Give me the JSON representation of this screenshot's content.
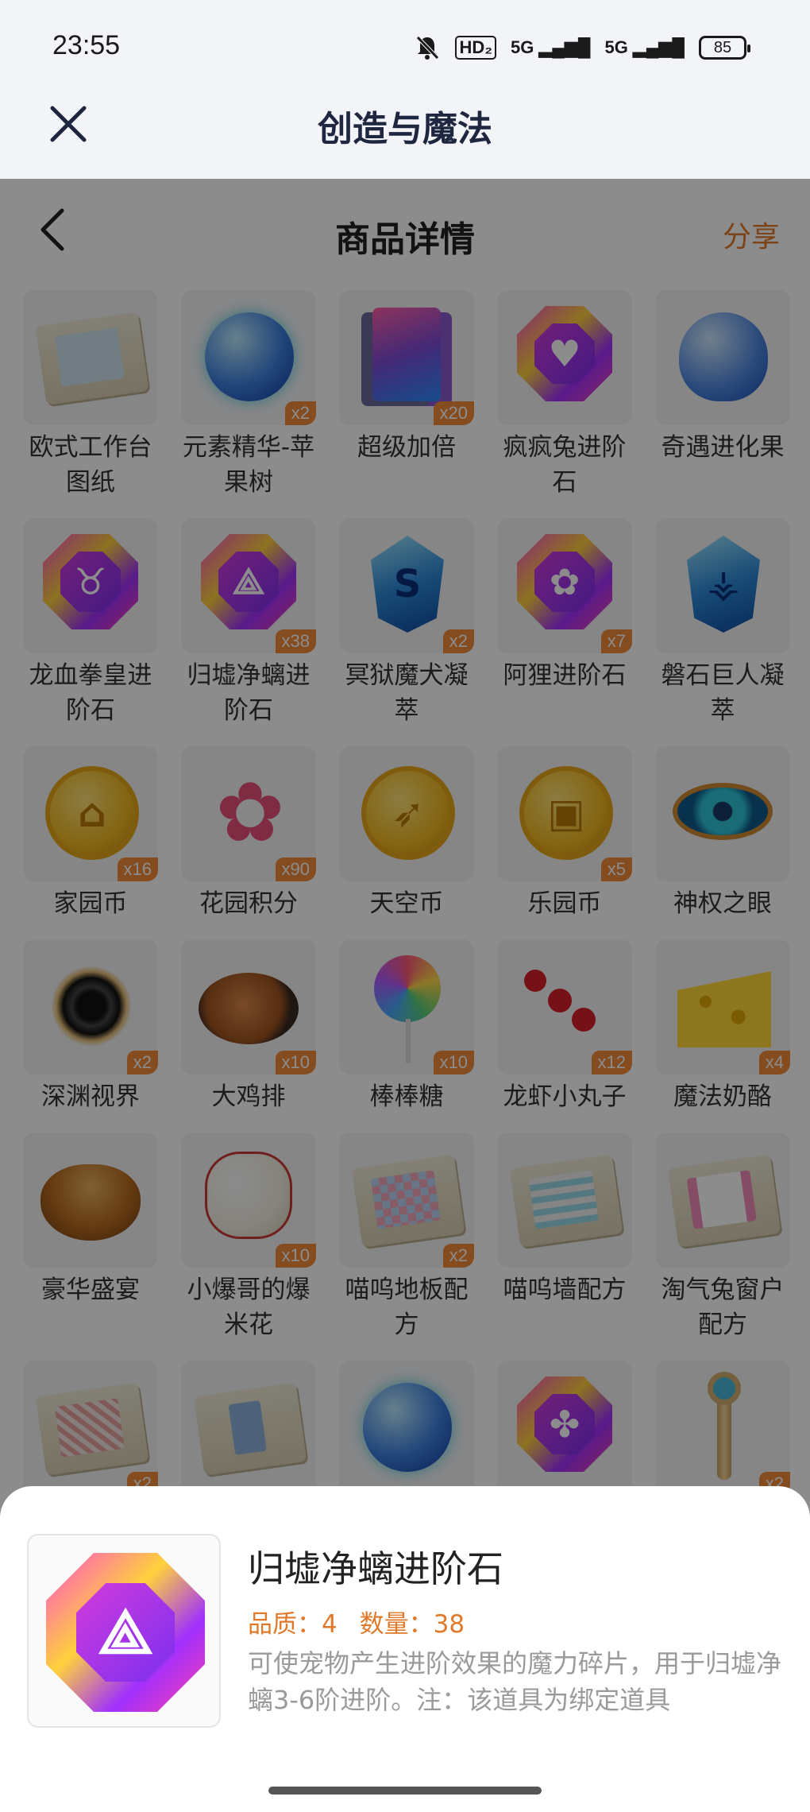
{
  "status_bar": {
    "time": "23:55",
    "hd": "HD₂",
    "sig1": "5G",
    "sig2": "5G",
    "battery": "85"
  },
  "app": {
    "title": "创造与魔法"
  },
  "page": {
    "title": "商品详情",
    "share": "分享"
  },
  "items": [
    {
      "name": "欧式工作台图纸",
      "qty": ""
    },
    {
      "name": "元素精华-苹果树",
      "qty": "x2"
    },
    {
      "name": "超级加倍",
      "qty": "x20"
    },
    {
      "name": "疯疯兔进阶石",
      "qty": ""
    },
    {
      "name": "奇遇进化果",
      "qty": ""
    },
    {
      "name": "龙血拳皇进阶石",
      "qty": ""
    },
    {
      "name": "归墟净螭进阶石",
      "qty": "x38"
    },
    {
      "name": "冥狱魔犬凝萃",
      "qty": "x2"
    },
    {
      "name": "阿狸进阶石",
      "qty": "x7"
    },
    {
      "name": "磐石巨人凝萃",
      "qty": ""
    },
    {
      "name": "家园币",
      "qty": "x16"
    },
    {
      "name": "花园积分",
      "qty": "x90"
    },
    {
      "name": "天空币",
      "qty": ""
    },
    {
      "name": "乐园币",
      "qty": "x5"
    },
    {
      "name": "神权之眼",
      "qty": ""
    },
    {
      "name": "深渊视界",
      "qty": "x2"
    },
    {
      "name": "大鸡排",
      "qty": "x10"
    },
    {
      "name": "棒棒糖",
      "qty": "x10"
    },
    {
      "name": "龙虾小丸子",
      "qty": "x12"
    },
    {
      "name": "魔法奶酪",
      "qty": "x4"
    },
    {
      "name": "豪华盛宴",
      "qty": ""
    },
    {
      "name": "小爆哥的爆米花",
      "qty": "x10"
    },
    {
      "name": "喵呜地板配方",
      "qty": "x2"
    },
    {
      "name": "喵呜墙配方",
      "qty": ""
    },
    {
      "name": "淘气兔窗户配方",
      "qty": ""
    },
    {
      "name": "",
      "qty": "x2"
    },
    {
      "name": "",
      "qty": ""
    },
    {
      "name": "",
      "qty": ""
    },
    {
      "name": "",
      "qty": ""
    },
    {
      "name": "",
      "qty": "x2"
    }
  ],
  "detail": {
    "title": "归墟净螭进阶石",
    "quality_label": "品质：4",
    "count_label": "数量：38",
    "description": "可使宠物产生进阶效果的魔力碎片，用于归墟净螭3-6阶进阶。注：该道具为绑定道具"
  },
  "colors": {
    "accent": "#e07a2a",
    "badge": "#f08a3a",
    "title": "#1f2640"
  }
}
